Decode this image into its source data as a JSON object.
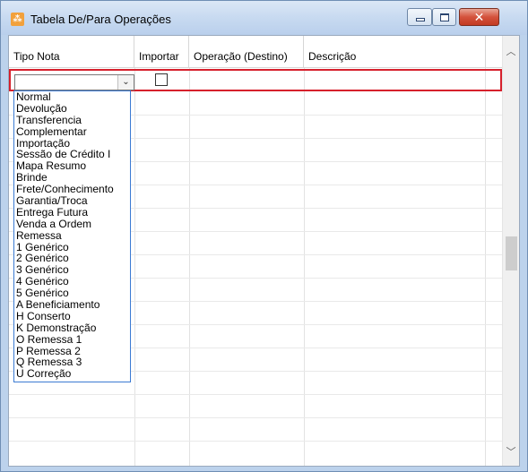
{
  "window": {
    "title": "Tabela De/Para Operações",
    "icon": "app-icon",
    "controls": {
      "minimize": "minimize-icon",
      "maximize": "maximize-icon",
      "close": "close-icon"
    }
  },
  "grid": {
    "columns": [
      {
        "label": "Tipo Nota"
      },
      {
        "label": "Importar"
      },
      {
        "label": "Operação (Destino)"
      },
      {
        "label": "Descrição"
      }
    ],
    "edit_row": {
      "tipo_nota_value": "",
      "importar_checked": false,
      "operacao_destino": "",
      "descricao": ""
    }
  },
  "dropdown": {
    "options": [
      "Normal",
      "Devolução",
      "Transferencia",
      "Complementar",
      "Importação",
      "Sessão de Crédito I",
      "Mapa Resumo",
      "Brinde",
      "Frete/Conhecimento",
      "Garantia/Troca",
      "Entrega Futura",
      "Venda a Ordem",
      "Remessa",
      "1 Genérico",
      "2 Genérico",
      "3 Genérico",
      "4 Genérico",
      "5 Genérico",
      "A Beneficiamento",
      "H Conserto",
      "K Demonstração",
      "O Remessa 1",
      "P Remessa 2",
      "Q Remessa 3",
      "U Correção"
    ]
  },
  "scrollbar": {
    "up_icon": "chevron-up-icon",
    "down_icon": "chevron-down-icon"
  },
  "colors": {
    "edit_row_border": "#d6202c",
    "dropdown_border": "#3c7bd3",
    "close_button": "#c23a22"
  }
}
